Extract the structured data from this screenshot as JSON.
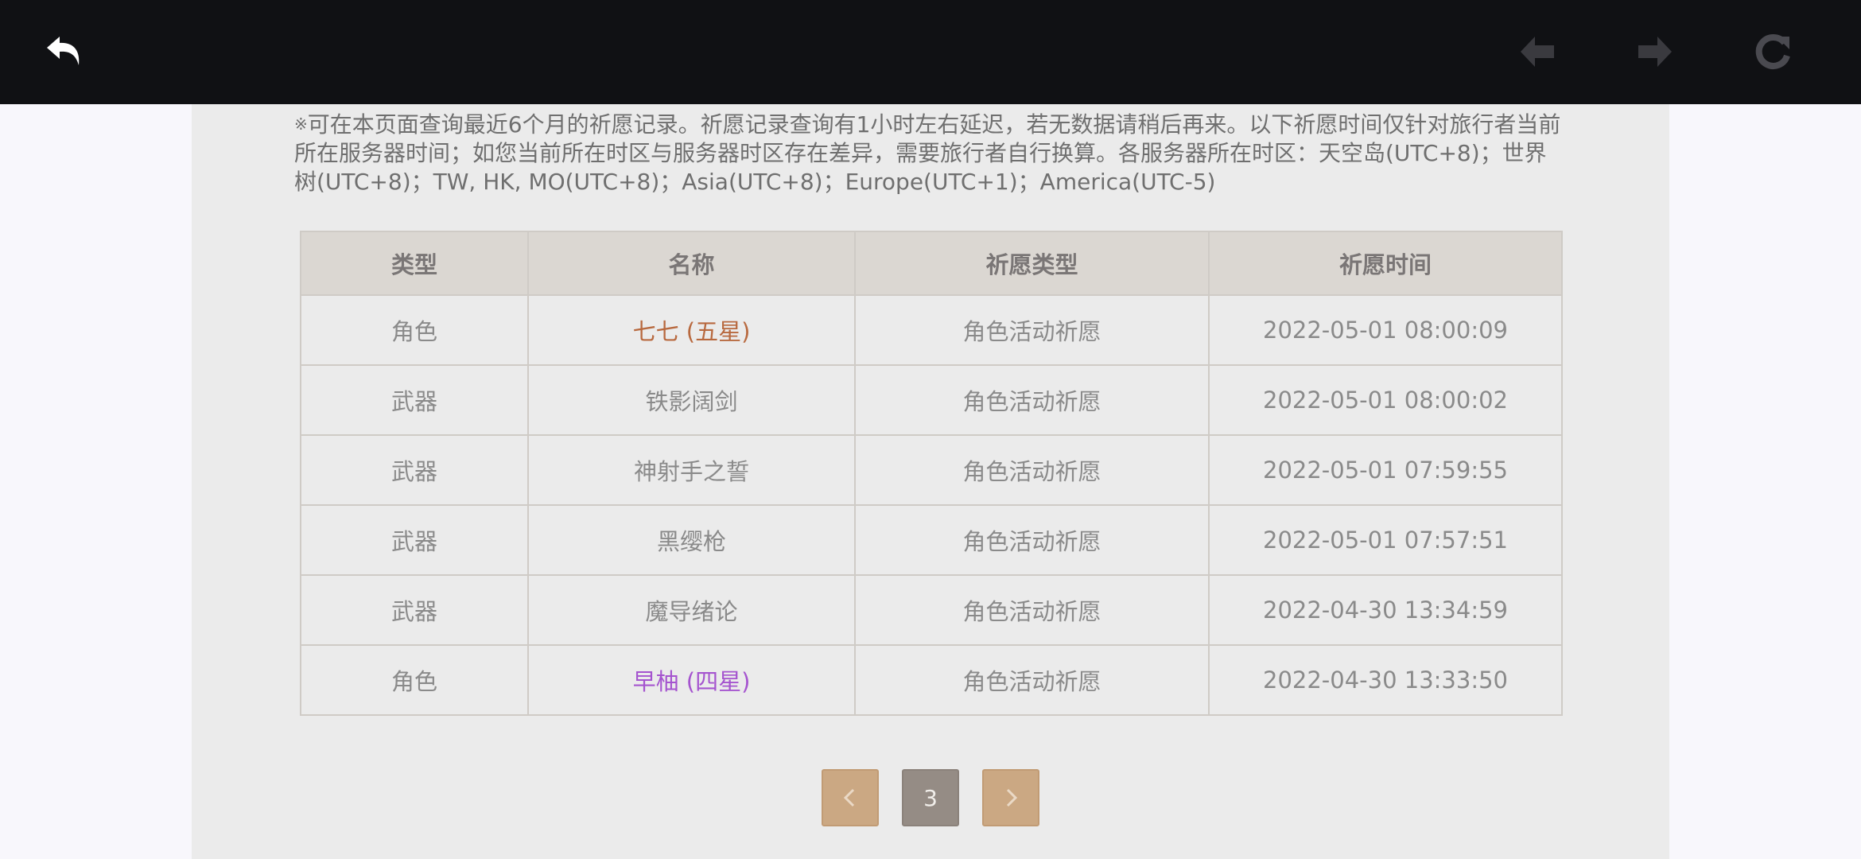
{
  "toolbar": {
    "back_icon": "undo-arrow-icon",
    "prev_icon": "back-arrow-icon",
    "next_icon": "forward-arrow-icon",
    "reload_icon": "reload-icon"
  },
  "notice": {
    "mark": "※",
    "text": "可在本页面查询最近6个月的祈愿记录。祈愿记录查询有1小时左右延迟，若无数据请稍后再来。以下祈愿时间仅针对旅行者当前所在服务器时间；如您当前所在时区与服务器时区存在差异，需要旅行者自行换算。各服务器所在时区：天空岛(UTC+8)；世界树(UTC+8)；TW, HK, MO(UTC+8)；Asia(UTC+8)；Europe(UTC+1)；America(UTC-5)"
  },
  "table": {
    "headers": [
      "类型",
      "名称",
      "祈愿类型",
      "祈愿时间"
    ],
    "rows": [
      {
        "type": "角色",
        "name": "七七 (五星)",
        "wish_type": "角色活动祈愿",
        "time": "2022-05-01 08:00:09"
      },
      {
        "type": "武器",
        "name": "铁影阔剑",
        "wish_type": "角色活动祈愿",
        "time": "2022-05-01 08:00:02"
      },
      {
        "type": "武器",
        "name": "神射手之誓",
        "wish_type": "角色活动祈愿",
        "time": "2022-05-01 07:59:55"
      },
      {
        "type": "武器",
        "name": "黑缨枪",
        "wish_type": "角色活动祈愿",
        "time": "2022-05-01 07:57:51"
      },
      {
        "type": "武器",
        "name": "魔导绪论",
        "wish_type": "角色活动祈愿",
        "time": "2022-04-30 13:34:59"
      },
      {
        "type": "角色",
        "name": "早柚 (四星)",
        "wish_type": "角色活动祈愿",
        "time": "2022-04-30 13:33:50"
      }
    ]
  },
  "pagination": {
    "current_page": "3",
    "prev_icon": "chevron-left-icon",
    "next_icon": "chevron-right-icon"
  },
  "colors": {
    "five_star": "#b8693f",
    "four_star": "#a554cf",
    "topbar": "#101114",
    "pager_button": "#cba883",
    "pager_current": "#958c85"
  }
}
